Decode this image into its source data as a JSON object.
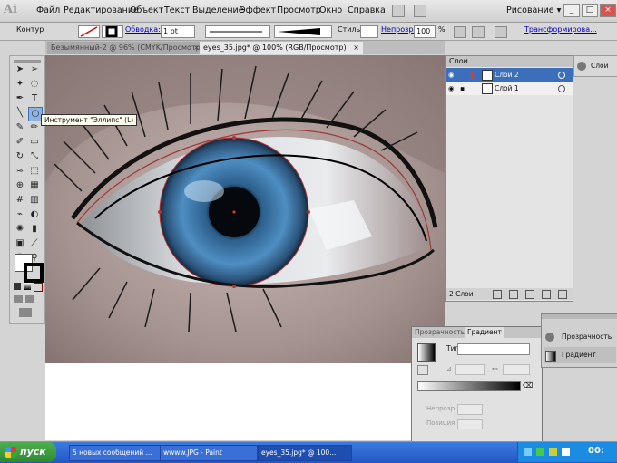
{
  "app": {
    "logo": "Ai",
    "workspace": "Рисование ▾"
  },
  "menu": [
    "Файл",
    "Редактирование",
    "Объект",
    "Текст",
    "Выделение",
    "Эффект",
    "Просмотр",
    "Окно",
    "Справка"
  ],
  "window_controls": {
    "minimize": "_",
    "restore": "□",
    "close": "×"
  },
  "controlbar": {
    "kontur": "Контур",
    "stroke_label": "Обводка:",
    "stroke_weight": "1 pt",
    "style_label": "Стиль:",
    "opacity_label": "Непрозр.:",
    "opacity_value": "100",
    "opacity_unit": "%",
    "transform": "Трансформирова..."
  },
  "tabs": [
    {
      "label": "Безымянный-2 @ 96% (CMYK/Просмотр)",
      "close": "×"
    },
    {
      "label": "eyes_35.jpg* @ 100% (RGB/Просмотр)",
      "close": "×"
    }
  ],
  "tooltip": "Инструмент \"Эллипс\" (L)",
  "layers": {
    "title": "Слои",
    "items": [
      "Слой 2",
      "Слой 1"
    ],
    "count": "2 Слои"
  },
  "dock_top": {
    "label": "Слои"
  },
  "gradient_panel": {
    "tab_transparency": "Прозрачность",
    "tab_gradient": "Градиент",
    "type_label": "Тип:",
    "field_opacity": "Непрозр.",
    "field_position": "Позиция"
  },
  "dock_side": {
    "item1": "Прозрачность",
    "item2": "Градиент"
  },
  "taskbar": {
    "start": "пуск",
    "tasks": [
      "5 новых сообщений ...",
      "wwww.JPG - Paint",
      "eyes_35.jpg* @ 100..."
    ],
    "clock": "00:"
  },
  "colors": {
    "accent": "#3c6fb9",
    "taskbar": "#2456c4",
    "start": "#2f8a2f"
  }
}
